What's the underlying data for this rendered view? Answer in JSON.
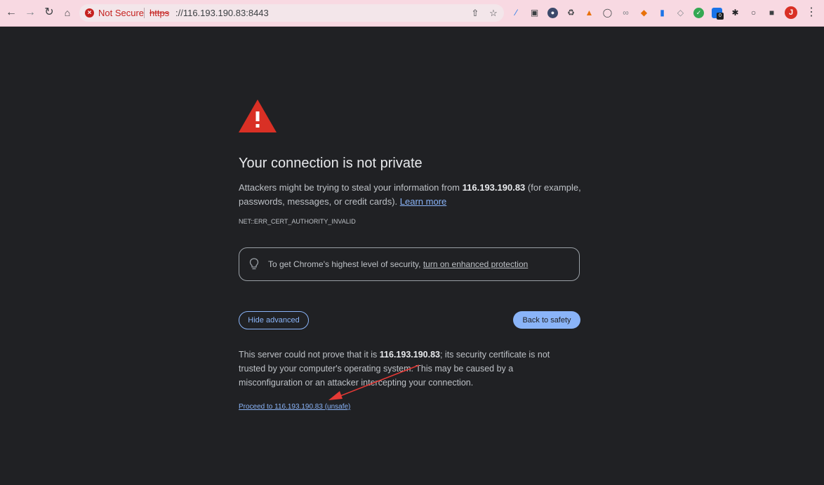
{
  "browser": {
    "security_label": "Not Secure",
    "url_scheme": "https",
    "url_host": "://116.193.190.83:8443",
    "extension_badge": "0",
    "profile_initial": "J"
  },
  "interstitial": {
    "heading": "Your connection is not private",
    "description": {
      "prefix": "Attackers might be trying to steal your information from ",
      "host": "116.193.190.83",
      "suffix": " (for example, passwords, messages, or credit cards). ",
      "learn_more": "Learn more"
    },
    "error_code": "NET::ERR_CERT_AUTHORITY_INVALID",
    "enhanced_protection": {
      "text": "To get Chrome's highest level of security, ",
      "link": "turn on enhanced protection"
    },
    "hide_advanced_label": "Hide advanced",
    "back_to_safety_label": "Back to safety",
    "details": {
      "prefix": "This server could not prove that it is ",
      "host": "116.193.190.83",
      "suffix": "; its security certificate is not trusted by your computer's operating system. This may be caused by a misconfiguration or an attacker intercepting your connection."
    },
    "proceed_link": "Proceed to 116.193.190.83 (unsafe)"
  },
  "colors": {
    "page_background": "#202124",
    "warning_red": "#d93025",
    "link_blue": "#8ab4f8",
    "annotation_arrow": "#e53935"
  },
  "icons": {
    "back": "arrow-left-icon",
    "forward": "arrow-right-icon",
    "reload": "reload-icon",
    "home": "home-icon",
    "share": "share-icon",
    "bookmark": "star-icon",
    "warning": "warning-triangle-icon",
    "tip": "lightbulb-icon",
    "menu": "kebab-menu-icon"
  }
}
